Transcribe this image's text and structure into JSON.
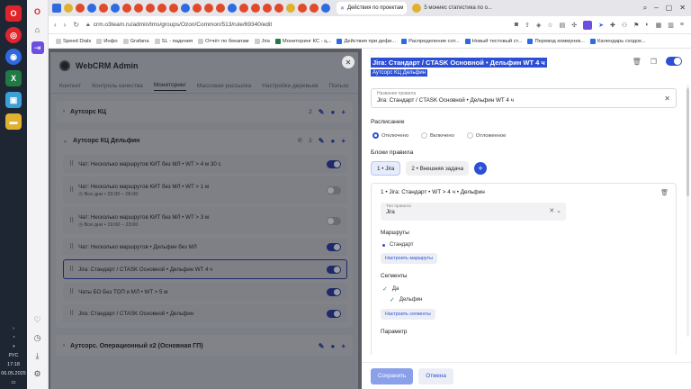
{
  "taskbar": {
    "lang": "РУС",
    "time": "17:18",
    "date": "06.05.2025"
  },
  "browser": {
    "tabs": [
      {
        "label": "Действия по проектам"
      },
      {
        "label": "5 мониес статистика по о..."
      }
    ],
    "url": "crm.o3team.ru/admin/tms/groups/Ozon/Common/513/rule/69340/edit",
    "bookmarks": [
      "Speed Dials",
      "Инфо",
      "Grafana",
      "SL - падения",
      "Отчёт по бекапам",
      "Jira",
      "Мониторинг КС - ц...",
      "Действия при дефи...",
      "Распределение сот...",
      "Новый тестовый ст...",
      "Перевод коммуник...",
      "Календарь сходок..."
    ]
  },
  "app": {
    "title": "WebCRM Admin",
    "nav": [
      "Контент",
      "Контроль качества",
      "Мониторинг",
      "Массовая рассылка",
      "Настройки деревьев",
      "Пользо"
    ],
    "active_nav": "Мониторинг",
    "groups": [
      {
        "title": "Аутсорс КЦ",
        "count": "2"
      },
      {
        "title": "Аутсорс КЦ Дельфин",
        "count": "2"
      },
      {
        "title": "Аутсорс. Операционный х2 (Основная ГП)"
      }
    ],
    "rules": [
      {
        "title": "Чат: Несколько маршрутов КИТ без МЛ • WT > 4 м 30 с",
        "sub": "",
        "on": true
      },
      {
        "title": "Чат: Несколько маршрутов КИТ без МЛ • WT > 1 м",
        "sub": "Все дни • 23:00 – 06:00",
        "on": false
      },
      {
        "title": "Чат: Несколько маршрутов КИТ без МЛ • WT > 3 м",
        "sub": "Все дни • 19:00 – 23:00",
        "on": false
      },
      {
        "title": "Чат: Несколько маршрутов • Дельфин без МЛ",
        "sub": "",
        "on": true
      },
      {
        "title": "Jira: Стандарт / CTASK Основной • Дельфин WT 4 ч",
        "sub": "",
        "on": true
      },
      {
        "title": "Чаты БО Без ТОП и МЛ • WT > 5 м",
        "sub": "",
        "on": true
      },
      {
        "title": "Jira: Стандарт / CTASK Основной • Дельфин",
        "sub": "",
        "on": true
      }
    ]
  },
  "panel": {
    "title": "Jira: Стандарт / CTASK Основной • Дельфин WT 4 ч",
    "subtitle": "Аутсорс КЦ Дельфин",
    "name_label": "Название правила",
    "name_value": "Jira: Стандарт / CTASK Основной • Дельфин WT 4 ч",
    "schedule_label": "Расписание",
    "schedule_options": [
      "Отключено",
      "Включено",
      "Отложенное"
    ],
    "schedule_selected": "Отключено",
    "blocks_label": "Блоки правила",
    "blocks": [
      "1 • Jira",
      "2 • Внешняя задача"
    ],
    "block": {
      "header": "1 • Jira: Стандарт • WT > 4 ч • Дельфин",
      "type_label": "Тип правила",
      "type_value": "Jira",
      "routes_label": "Маршруты",
      "route_item": "Стандарт",
      "routes_btn": "Настроить маршруты",
      "segments_label": "Сегменты",
      "seg_yes": "Да",
      "seg_item": "Дельфин",
      "segments_btn": "Настроить сегменты",
      "param_label": "Параметр"
    },
    "save": "Сохранить",
    "cancel": "Отмена"
  },
  "colors": {
    "accent": "#2c4fd6",
    "taskbar": "#1e2633"
  }
}
